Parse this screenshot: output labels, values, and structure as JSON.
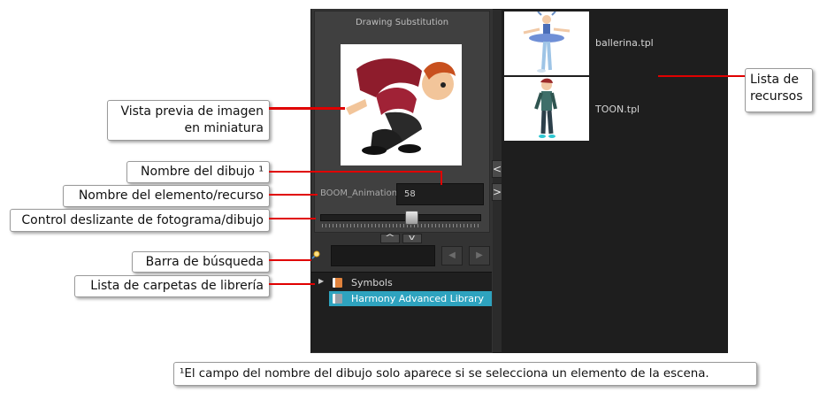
{
  "panel": {
    "title": "Drawing Substitution",
    "drawing_label": "BOOM_Animation",
    "drawing_value": "58",
    "prev_icon": "chevron-left-icon",
    "next_icon": "chevron-right-icon",
    "collapse_up": "^",
    "collapse_down": "v",
    "nav_back": "◀",
    "nav_forward": "▶",
    "side_prev": "<",
    "side_next": ">"
  },
  "library": {
    "folders": [
      {
        "label": "Symbols",
        "selected": false
      },
      {
        "label": "Harmony Advanced Library",
        "selected": true
      }
    ]
  },
  "assets": [
    {
      "name": "ballerina.tpl"
    },
    {
      "name": "TOON.tpl"
    }
  ],
  "callouts": {
    "thumbnail_line1": "Vista previa de imagen",
    "thumbnail_line2": "en miniatura",
    "drawing_name": "Nombre del dibujo ¹",
    "element_name": "Nombre del elemento/recurso",
    "slider": "Control deslizante de fotograma/dibujo",
    "search": "Barra de búsqueda",
    "folders": "Lista de carpetas de librería",
    "assets_line1": "Lista de",
    "assets_line2": "recursos"
  },
  "footnote": "¹El campo del nombre del dibujo solo aparece si se selecciona un elemento de la escena.",
  "colors": {
    "highlight": "#2ea3bf",
    "callout_line": "#e00000"
  }
}
